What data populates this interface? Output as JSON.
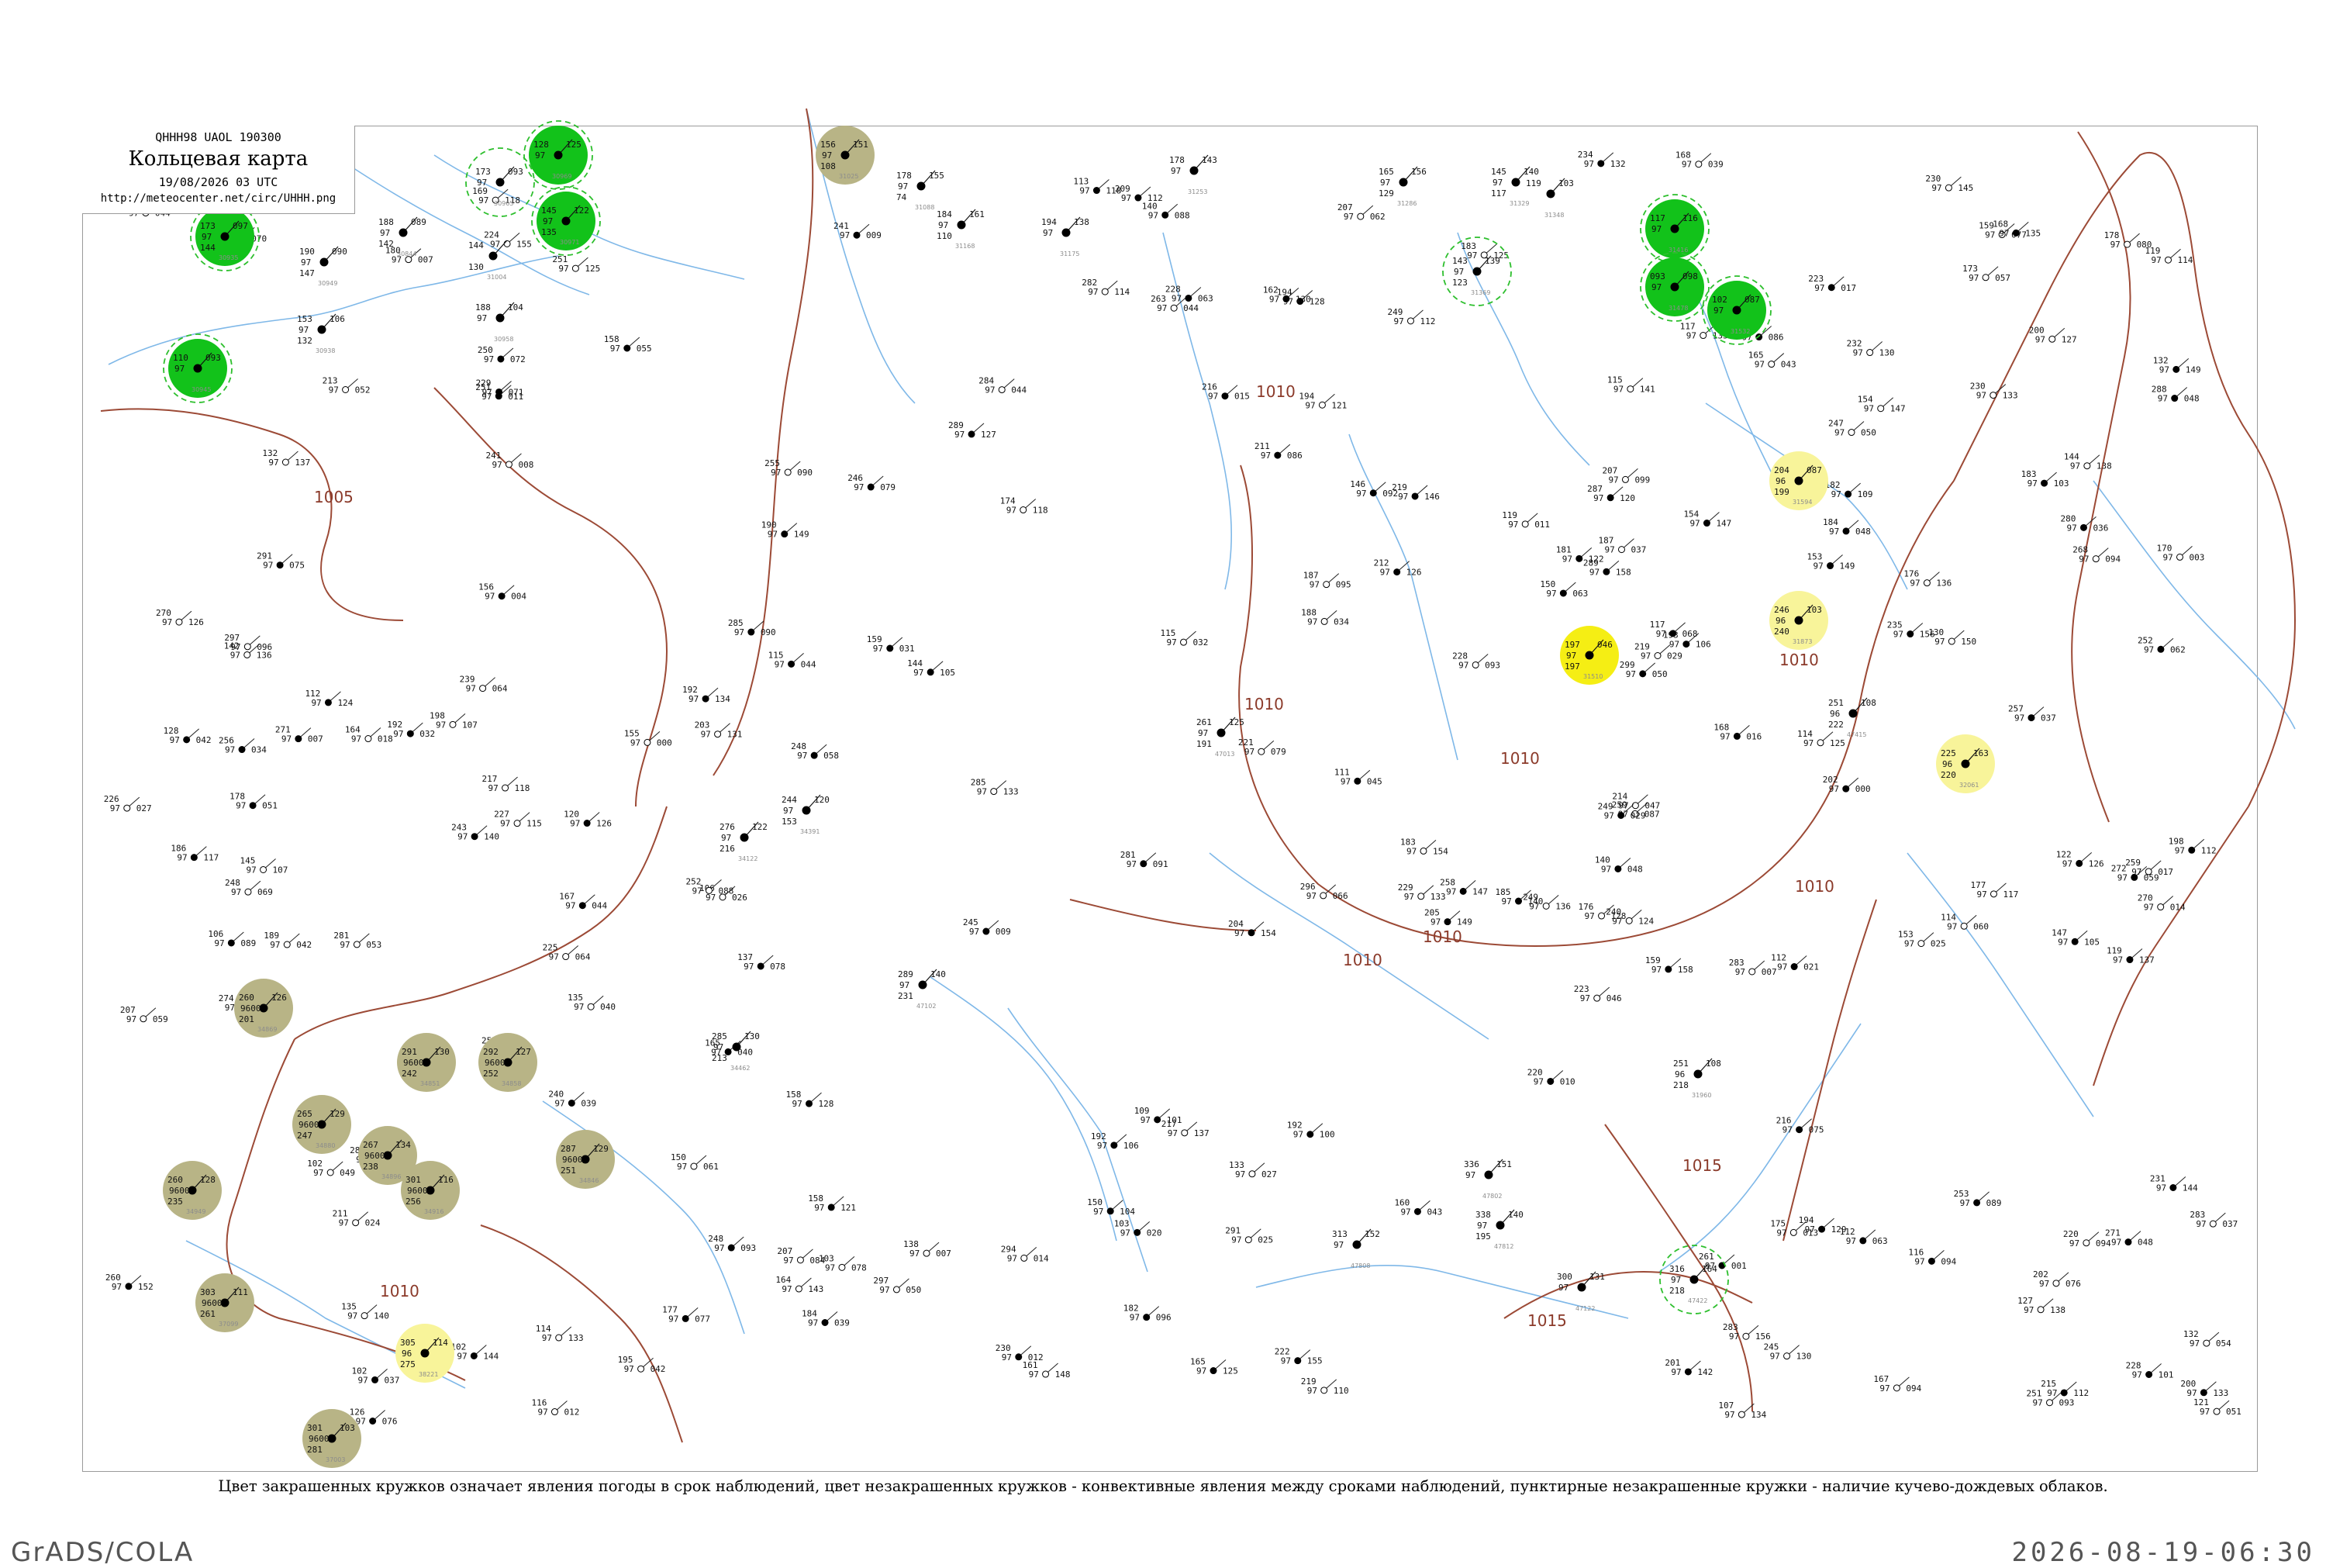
{
  "header": {
    "bulletin_code": "QHHH98  UAOL  190300",
    "title": "Кольцевая карта",
    "date": "19/08/2026 03 UTC",
    "url": "http://meteocenter.net/circ/UHHH.png"
  },
  "caption": "Цвет закрашенных кружков означает явления погоды в срок наблюдений, цвет незакрашенных кружков - конвективные явления между сроками наблюдений, пунктирные незакрашенные кружки - наличие кучево-дождевых облаков.",
  "footer": {
    "software": "GrADS/COLA",
    "timestamp": "2026-08-19-06:30"
  },
  "colors": {
    "rain_fill": "#12c21a",
    "haze_fill": "#b8b486",
    "fog_fill": "#f5ee14",
    "fog_light_fill": "#f8f49a",
    "cb_dashed": "#2dbf2d",
    "isobar": "#9c4a36",
    "river": "#7fb8e8",
    "station_id": "#8c8c8c"
  },
  "isobar_labels": [
    "1005",
    "1010",
    "1010",
    "1010",
    "1010",
    "1010",
    "1010",
    "1010",
    "1015",
    "1015",
    "1010"
  ],
  "stations": [
    {
      "t": "173",
      "p": "097",
      "v": "97",
      "d": "144",
      "id": "30935",
      "c": "rain"
    },
    {
      "t": "110",
      "p": "093",
      "v": "97",
      "d": "",
      "id": "30945",
      "c": "rain"
    },
    {
      "t": "190",
      "p": "090",
      "v": "97",
      "d": "147",
      "id": "30949",
      "c": ""
    },
    {
      "t": "188",
      "p": "089",
      "v": "97",
      "d": "142",
      "id": "30844",
      "c": ""
    },
    {
      "t": "153",
      "p": "106",
      "v": "97",
      "d": "132",
      "id": "30938",
      "c": ""
    },
    {
      "t": "188",
      "p": "104",
      "v": "97",
      "d": "",
      "id": "30958",
      "c": ""
    },
    {
      "t": "173",
      "p": "093",
      "v": "97",
      "d": "",
      "id": "30965",
      "c": "cb"
    },
    {
      "t": "128",
      "p": "125",
      "v": "97",
      "d": "",
      "id": "30969",
      "c": "rain"
    },
    {
      "t": "145",
      "p": "122",
      "v": "97",
      "d": "135",
      "id": "30971",
      "c": "rain"
    },
    {
      "t": "144",
      "p": "",
      "v": "",
      "d": "130",
      "id": "31004",
      "c": ""
    },
    {
      "t": "156",
      "p": "151",
      "v": "97",
      "d": "108",
      "id": "31025",
      "c": "haze"
    },
    {
      "t": "178",
      "p": "155",
      "v": "97",
      "d": "74",
      "id": "31088",
      "c": ""
    },
    {
      "t": "184",
      "p": "161",
      "v": "97",
      "d": "110",
      "id": "31168",
      "c": ""
    },
    {
      "t": "194",
      "p": "138",
      "v": "97",
      "d": "",
      "id": "31175",
      "c": ""
    },
    {
      "t": "178",
      "p": "143",
      "v": "97",
      "d": "",
      "id": "31253",
      "c": ""
    },
    {
      "t": "165",
      "p": "156",
      "v": "97",
      "d": "129",
      "id": "31286",
      "c": ""
    },
    {
      "t": "145",
      "p": "140",
      "v": "97",
      "d": "117",
      "id": "31329",
      "c": ""
    },
    {
      "t": "119",
      "p": "103",
      "v": "",
      "d": "",
      "id": "31348",
      "c": ""
    },
    {
      "t": "143",
      "p": "139",
      "v": "97",
      "d": "123",
      "id": "31369",
      "c": "cb"
    },
    {
      "t": "117",
      "p": "116",
      "v": "97",
      "d": "",
      "id": "31416",
      "c": "rain"
    },
    {
      "t": "093",
      "p": "098",
      "v": "97",
      "d": "",
      "id": "31478",
      "c": "rain"
    },
    {
      "t": "102",
      "p": "087",
      "v": "97",
      "d": "",
      "id": "31532",
      "c": "rain"
    },
    {
      "t": "204",
      "p": "087",
      "v": "96",
      "d": "199",
      "id": "31594",
      "c": "fog"
    },
    {
      "t": "197",
      "p": "046",
      "v": "97",
      "d": "197",
      "id": "31510",
      "c": "fog_strong"
    },
    {
      "t": "246",
      "p": "103",
      "v": "96",
      "d": "240",
      "id": "31873",
      "c": "fog"
    },
    {
      "t": "225",
      "p": "163",
      "v": "96",
      "d": "220",
      "id": "32061",
      "c": "fog"
    },
    {
      "t": "251",
      "p": "108",
      "v": "96",
      "d": "218",
      "id": "31960",
      "c": ""
    },
    {
      "t": "260",
      "p": "126",
      "v": "9600",
      "d": "201",
      "id": "34869",
      "c": "haze"
    },
    {
      "t": "291",
      "p": "130",
      "v": "9600",
      "d": "242",
      "id": "34851",
      "c": "haze"
    },
    {
      "t": "292",
      "p": "127",
      "v": "9600",
      "d": "252",
      "id": "34858",
      "c": "haze"
    },
    {
      "t": "265",
      "p": "129",
      "v": "9600",
      "d": "247",
      "id": "34880",
      "c": "haze"
    },
    {
      "t": "267",
      "p": "134",
      "v": "9600",
      "d": "238",
      "id": "34896",
      "c": "haze"
    },
    {
      "t": "260",
      "p": "128",
      "v": "9600",
      "d": "235",
      "id": "34949",
      "c": "haze"
    },
    {
      "t": "301",
      "p": "116",
      "v": "9600",
      "d": "256",
      "id": "34916",
      "c": "haze"
    },
    {
      "t": "287",
      "p": "129",
      "v": "9600",
      "d": "251",
      "id": "34846",
      "c": "haze"
    },
    {
      "t": "303",
      "p": "111",
      "v": "9600",
      "d": "261",
      "id": "37099",
      "c": "haze"
    },
    {
      "t": "305",
      "p": "114",
      "v": "96",
      "d": "275",
      "id": "38221",
      "c": "fog"
    },
    {
      "t": "301",
      "p": "103",
      "v": "9600",
      "d": "281",
      "id": "37003",
      "c": "haze"
    },
    {
      "t": "336",
      "p": "151",
      "v": "97",
      "d": "",
      "id": "47802",
      "c": ""
    },
    {
      "t": "316",
      "p": "164",
      "v": "97",
      "d": "218",
      "id": "47422",
      "c": "cb"
    },
    {
      "t": "338",
      "p": "140",
      "v": "97",
      "d": "195",
      "id": "47812",
      "c": ""
    },
    {
      "t": "300",
      "p": "131",
      "v": "97",
      "d": "",
      "id": "47122",
      "c": ""
    },
    {
      "t": "313",
      "p": "152",
      "v": "97",
      "d": "",
      "id": "47808",
      "c": ""
    },
    {
      "t": "244",
      "p": "120",
      "v": "97",
      "d": "153",
      "id": "34391",
      "c": ""
    },
    {
      "t": "285",
      "p": "130",
      "v": "97",
      "d": "213",
      "id": "34462",
      "c": ""
    },
    {
      "t": "276",
      "p": "122",
      "v": "97",
      "d": "216",
      "id": "34122",
      "c": ""
    },
    {
      "t": "289",
      "p": "140",
      "v": "97",
      "d": "231",
      "id": "47102",
      "c": ""
    },
    {
      "t": "261",
      "p": "125",
      "v": "97",
      "d": "191",
      "id": "47013",
      "c": ""
    },
    {
      "t": "251",
      "p": "108",
      "v": "96",
      "d": "222",
      "id": "47415",
      "c": ""
    }
  ]
}
